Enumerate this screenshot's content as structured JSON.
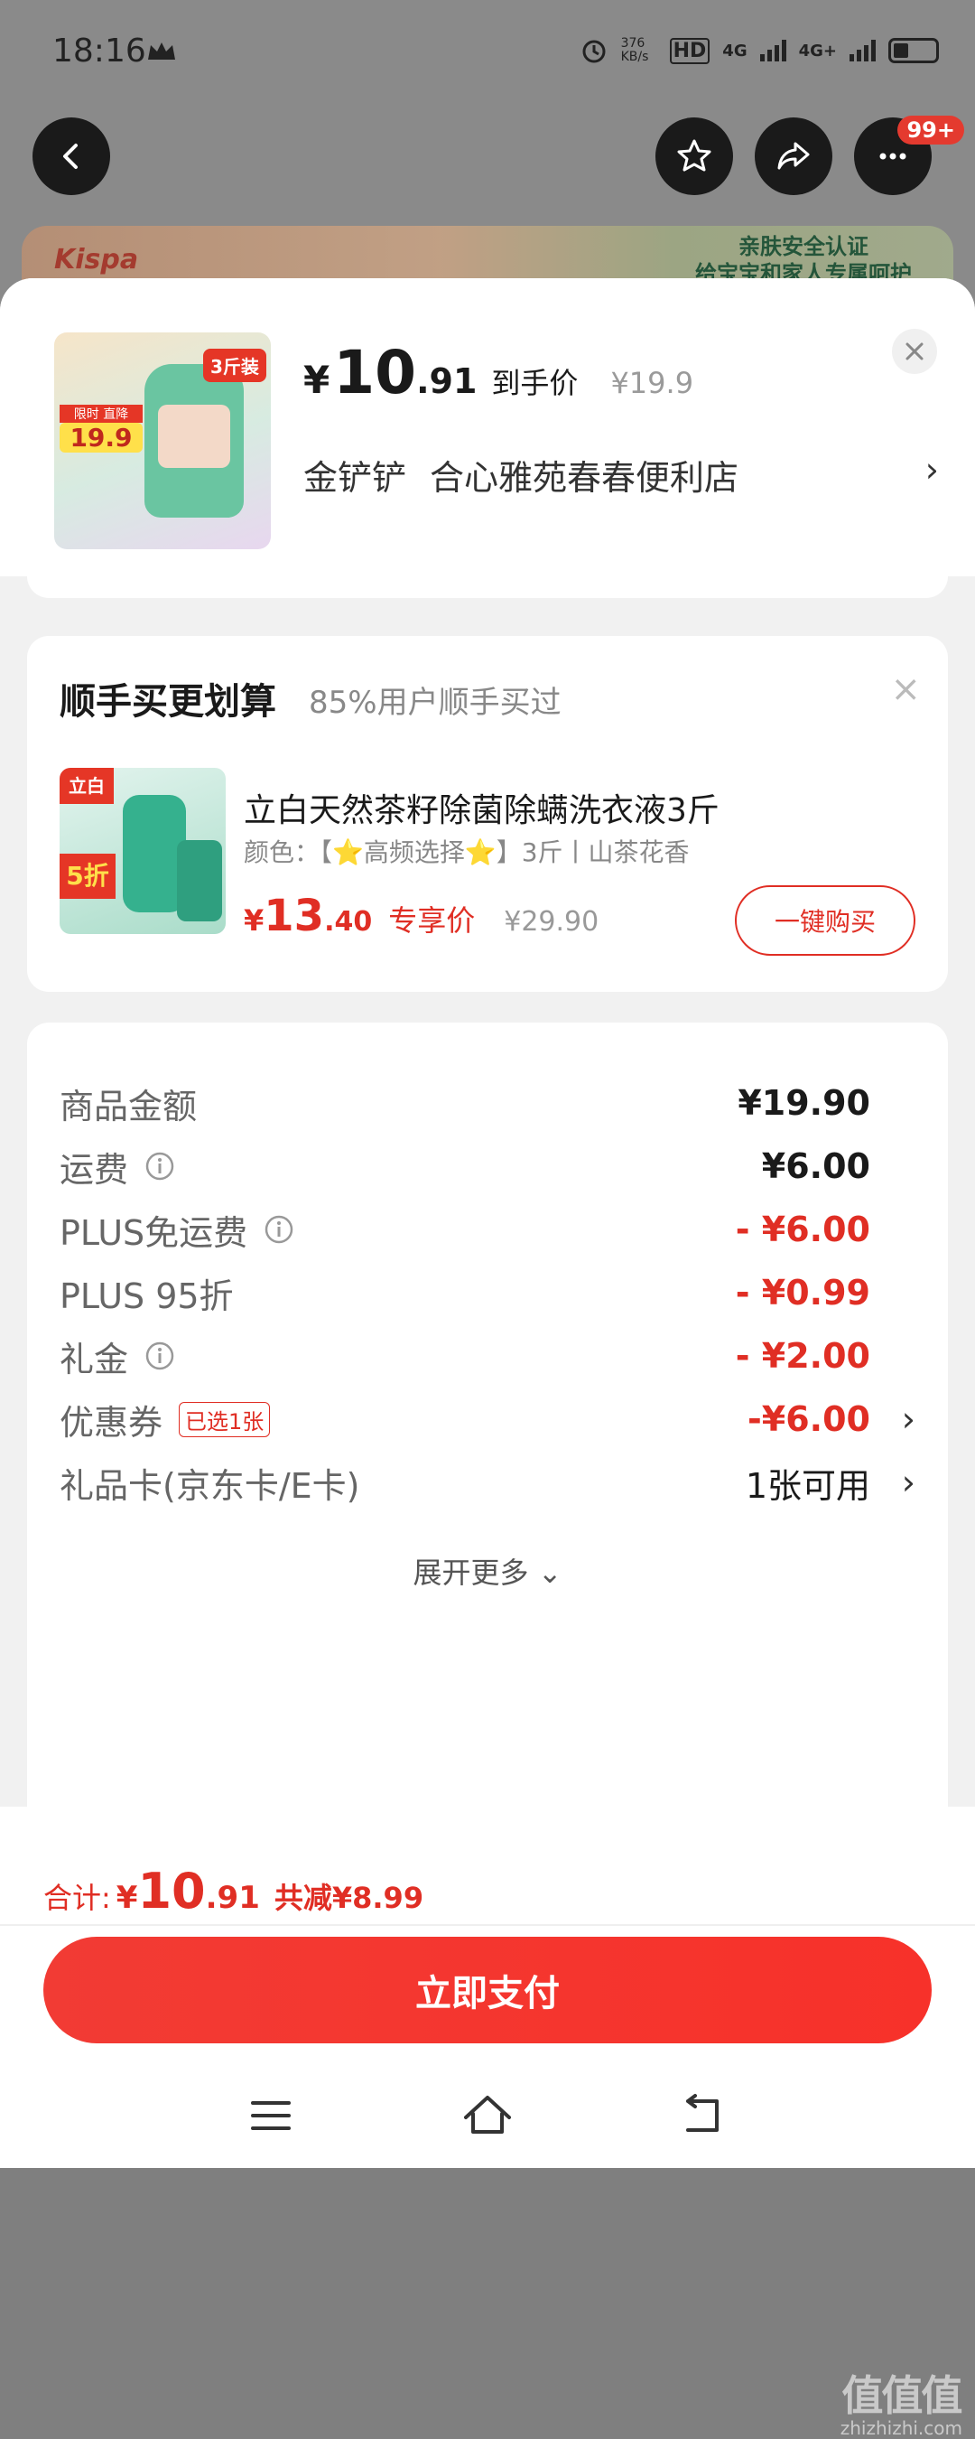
{
  "status": {
    "time": "18:16",
    "net_speed": "376 KB/s",
    "hd": "HD",
    "sig1": "4G",
    "sig2": "4G+"
  },
  "topbar": {
    "badge": "99+"
  },
  "background": {
    "brand": "Kispa",
    "cert_line1": "亲肤安全认证",
    "cert_line2": "给宝宝和家人专属呵护"
  },
  "header": {
    "yen": "¥",
    "price_int": "10",
    "price_dec": ".91",
    "price_label": "到手价",
    "orig_price": "¥19.9",
    "store_a": "金铲铲",
    "store_b": "合心雅苑春春便利店",
    "thumb_tag": "3斤装",
    "thumb_price_sub": "限时 直降",
    "thumb_price": "19.9"
  },
  "upsell": {
    "title": "顺手买更划算",
    "subtitle": "85%用户顺手买过",
    "name": "立白天然茶籽除菌除螨洗衣液3斤",
    "spec": "颜色：【⭐高频选择⭐】3斤丨山茶花香",
    "yen": "¥",
    "price_int": "13",
    "price_dec": ".40",
    "price_label": "专享价",
    "orig_price": "¥29.90",
    "buy_label": "一键购买",
    "thumb_brand": "立白",
    "thumb_discount": "5折"
  },
  "details": {
    "rows": [
      {
        "label": "商品金额",
        "value": "¥19.90"
      },
      {
        "label": "运费",
        "value": "¥6.00"
      },
      {
        "label": "PLUS免运费",
        "value": "- ¥6.00"
      },
      {
        "label": "PLUS 95折",
        "value": "- ¥0.99"
      },
      {
        "label": "礼金",
        "value": "- ¥2.00"
      },
      {
        "label": "优惠券",
        "tag": "已选1张",
        "value": "-¥6.00"
      },
      {
        "label": "礼品卡(京东卡/E卡)",
        "value": "1张可用"
      }
    ],
    "expand": "展开更多"
  },
  "summary": {
    "label": "合计:",
    "yen": "¥",
    "total_int": "10",
    "total_dec": ".91",
    "reduced": "共减¥8.99"
  },
  "pay_label": "立即支付",
  "watermark": {
    "big": "值值值",
    "small": "zhizhizhi.com"
  },
  "colors": {
    "accent": "#e02e24",
    "pay_button": "#f23b34"
  }
}
